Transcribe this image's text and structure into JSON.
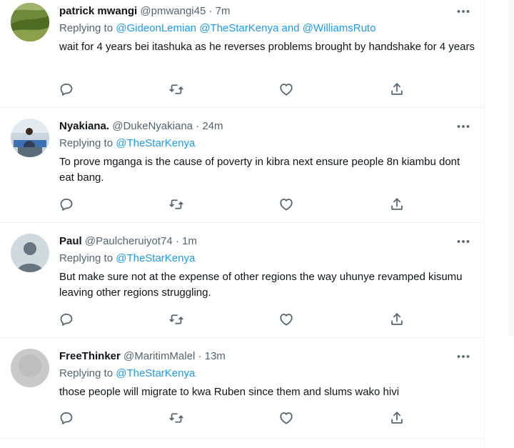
{
  "tweets": [
    {
      "name": "patrick mwangi",
      "handle": "@pmwangi45",
      "sep": "·",
      "time": "7m",
      "reply_prefix": "Replying to",
      "mentions": [
        "@GideonLemian",
        "@TheStarKenya"
      ],
      "and_word": "and",
      "last_mention": "@WilliamsRuto",
      "text": "wait for 4 years bei itashuka as he reverses problems brought by handshake for 4 years"
    },
    {
      "name": "Nyakiana.",
      "handle": "@DukeNyakiana",
      "sep": "·",
      "time": "24m",
      "reply_prefix": "Replying to",
      "mention": "@TheStarKenya",
      "text": "To prove mganga is the cause of poverty in kibra next ensure people 8n kiambu dont eat bang."
    },
    {
      "name": "Paul",
      "handle": "@Paulcheruiyot74",
      "sep": "·",
      "time": "1m",
      "reply_prefix": "Replying to",
      "mention": "@TheStarKenya",
      "text": "But make sure not at the expense of other regions the way uhunye revamped kisumu leaving other regions struggling."
    },
    {
      "name": "FreeThinker",
      "handle": "@MaritimMalel",
      "sep": "·",
      "time": "13m",
      "reply_prefix": "Replying to",
      "mention": "@TheStarKenya",
      "text": "those people will migrate to kwa Ruben since them and slums wako hivi"
    }
  ],
  "colors": {
    "text": "#0f1419",
    "secondary": "#536471",
    "link": "#1d9bf0",
    "divider": "#eff3f4"
  },
  "icons": [
    "reply-icon",
    "retweet-icon",
    "like-icon",
    "share-icon",
    "more-icon"
  ]
}
